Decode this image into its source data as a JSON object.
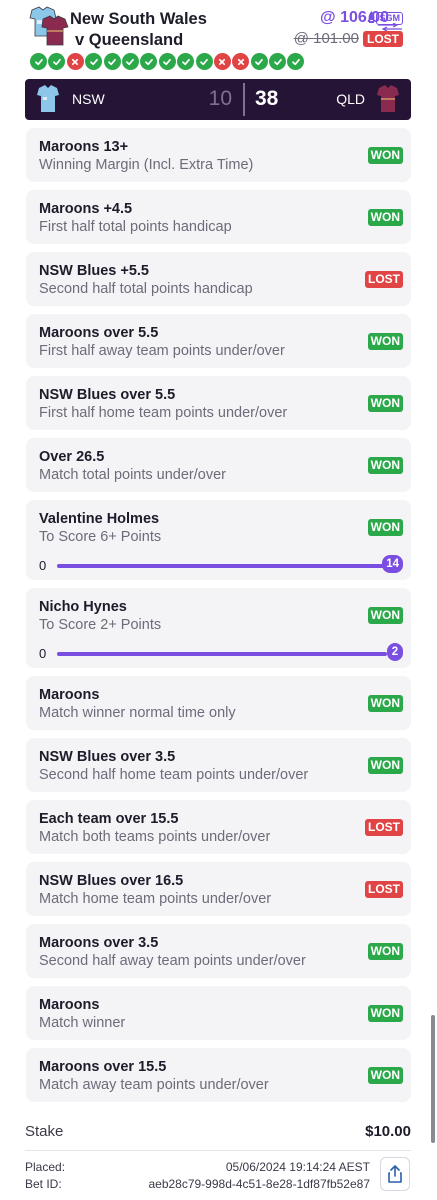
{
  "header": {
    "title_line1": "New South Wales",
    "title_line2": "v Queensland",
    "odds": "106.00",
    "at_symbol": "@",
    "old_odds_prefix": "@",
    "old_odds": "101.00",
    "product_badge": "SGM",
    "status": "LOST",
    "leg_results": [
      "won",
      "won",
      "lost",
      "won",
      "won",
      "won",
      "won",
      "won",
      "won",
      "won",
      "lost",
      "lost",
      "won",
      "won",
      "won"
    ]
  },
  "scoreboard": {
    "home_team": "NSW",
    "home_score": "10",
    "away_team": "QLD",
    "away_score": "38"
  },
  "legs": [
    {
      "title": "Maroons 13+",
      "subtitle": "Winning Margin (Incl. Extra Time)",
      "result": "WON",
      "status": "won"
    },
    {
      "title": "Maroons +4.5",
      "subtitle": "First half total points handicap",
      "result": "WON",
      "status": "won"
    },
    {
      "title": "NSW Blues +5.5",
      "subtitle": "Second half total points handicap",
      "result": "LOST",
      "status": "lost"
    },
    {
      "title": "Maroons over 5.5",
      "subtitle": "First half away team points under/over",
      "result": "WON",
      "status": "won"
    },
    {
      "title": "NSW Blues over 5.5",
      "subtitle": "First half home team points under/over",
      "result": "WON",
      "status": "won"
    },
    {
      "title": "Over 26.5",
      "subtitle": "Match total points under/over",
      "result": "WON",
      "status": "won"
    },
    {
      "title": "Valentine Holmes",
      "subtitle": "To Score 6+ Points",
      "result": "WON",
      "status": "won",
      "progress": {
        "min": "0",
        "max": "14",
        "fraction": 1.0
      }
    },
    {
      "title": "Nicho Hynes",
      "subtitle": "To Score 2+ Points",
      "result": "WON",
      "status": "won",
      "progress": {
        "min": "0",
        "max": "2",
        "fraction": 1.0
      }
    },
    {
      "title": "Maroons",
      "subtitle": "Match winner normal time only",
      "result": "WON",
      "status": "won"
    },
    {
      "title": "NSW Blues over 3.5",
      "subtitle": "Second half home team points under/over",
      "result": "WON",
      "status": "won"
    },
    {
      "title": "Each team over 15.5",
      "subtitle": "Match both teams points under/over",
      "result": "LOST",
      "status": "lost"
    },
    {
      "title": "NSW Blues over 16.5",
      "subtitle": "Match home team points under/over",
      "result": "LOST",
      "status": "lost"
    },
    {
      "title": "Maroons over 3.5",
      "subtitle": "Second half away team points under/over",
      "result": "WON",
      "status": "won"
    },
    {
      "title": "Maroons",
      "subtitle": "Match winner",
      "result": "WON",
      "status": "won"
    },
    {
      "title": "Maroons over 15.5",
      "subtitle": "Match away team points under/over",
      "result": "WON",
      "status": "won"
    }
  ],
  "footer": {
    "stake_label": "Stake",
    "stake_value": "$10.00",
    "placed_label": "Placed:",
    "placed_value": "05/06/2024 19:14:24 AEST",
    "bet_id_label": "Bet ID:",
    "bet_id_value": "aeb28c79-998d-4c51-8e28-1df87fb52e87"
  },
  "colors": {
    "accent": "#7a4ee0",
    "won": "#2ba84a",
    "lost": "#e04444",
    "scoreboard_bg": "#251436",
    "nsw_blue": "#8cc7ea",
    "qld_maroon": "#8a2a4e"
  }
}
